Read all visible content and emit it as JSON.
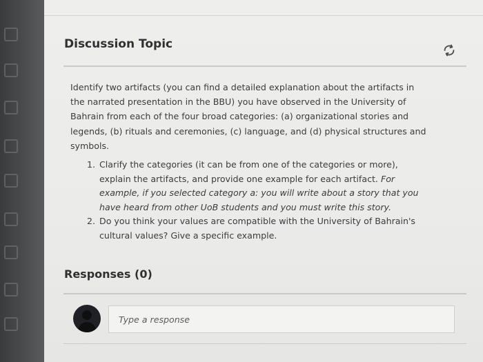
{
  "discussion": {
    "title": "Discussion Topic",
    "intro": "Identify two artifacts (you can find a detailed explanation about the artifacts in the narrated presentation in the BBU) you have observed in the University of Bahrain from each of the four broad categories: (a) organizational stories and legends, (b) rituals and ceremonies, (c) language, and (d) physical structures and symbols.",
    "items": [
      {
        "number": "1.",
        "text": "Clarify the categories (it can be from one of the categories or more), explain the artifacts, and provide one example for each artifact.",
        "example": "For example, if you selected category a: you will write about a story that you have heard from other UoB students and you must write this story."
      },
      {
        "number": "2.",
        "text": "Do you think your values are compatible with the University of Bahrain's cultural values? Give a specific example."
      }
    ]
  },
  "responses": {
    "title": "Responses (0)",
    "input_placeholder": "Type a response"
  },
  "icons": {
    "refresh": "refresh-icon",
    "avatar": "user-avatar-icon"
  }
}
